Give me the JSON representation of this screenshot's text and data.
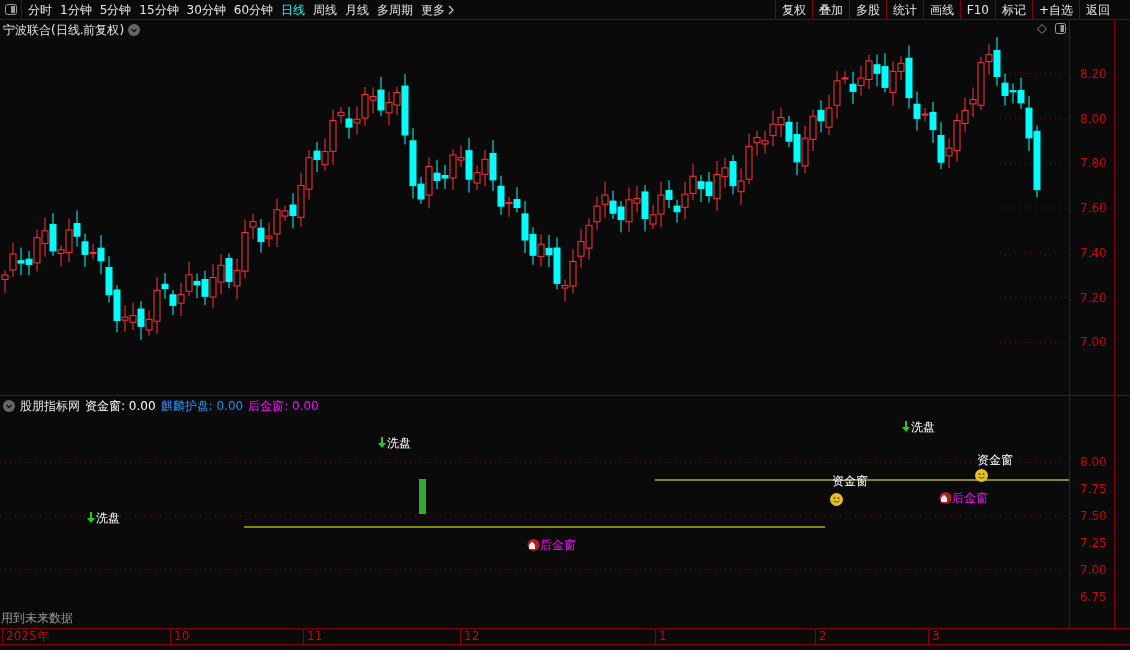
{
  "toolbar": {
    "periods": [
      {
        "label": "分时",
        "selected": false
      },
      {
        "label": "1分钟",
        "selected": false
      },
      {
        "label": "5分钟",
        "selected": false
      },
      {
        "label": "15分钟",
        "selected": false
      },
      {
        "label": "30分钟",
        "selected": false
      },
      {
        "label": "60分钟",
        "selected": false
      },
      {
        "label": "日线",
        "selected": true
      },
      {
        "label": "周线",
        "selected": false
      },
      {
        "label": "月线",
        "selected": false
      },
      {
        "label": "多周期",
        "selected": false
      },
      {
        "label": "更多",
        "selected": false
      }
    ],
    "actions": [
      "复权",
      "叠加",
      "多股",
      "统计",
      "画线",
      "F10",
      "标记",
      "+自选",
      "返回"
    ]
  },
  "main_chart": {
    "title": "宁波联合(日线.前复权)",
    "y_axis": [
      "8.20",
      "8.00",
      "7.80",
      "7.60",
      "7.40",
      "7.20",
      "7.00"
    ]
  },
  "indicator_panel": {
    "name": "股朋指标网",
    "values": [
      {
        "label": "资金窗:",
        "value": "0.00",
        "color": "#ffffff"
      },
      {
        "label": "麒麟护盘:",
        "value": "0.00",
        "color": "#1e90ff"
      },
      {
        "label": "后金窗:",
        "value": "0.00",
        "color": "#ff00ff"
      }
    ],
    "y_axis": [
      "8.00",
      "7.75",
      "7.50",
      "7.25",
      "7.00",
      "6.75"
    ],
    "markers": [
      {
        "kind": "wash",
        "text": "洗盘"
      },
      {
        "kind": "wash",
        "text": "洗盘"
      },
      {
        "kind": "wash",
        "text": "洗盘"
      },
      {
        "kind": "fund",
        "text": "资金窗"
      },
      {
        "kind": "fund",
        "text": "资金窗"
      },
      {
        "kind": "late",
        "text": "后金窗"
      },
      {
        "kind": "late",
        "text": "后金窗"
      }
    ],
    "note": "用到未来数据"
  },
  "time_axis": [
    "2025年",
    "10",
    "11",
    "12",
    "1",
    "2",
    "3"
  ]
}
